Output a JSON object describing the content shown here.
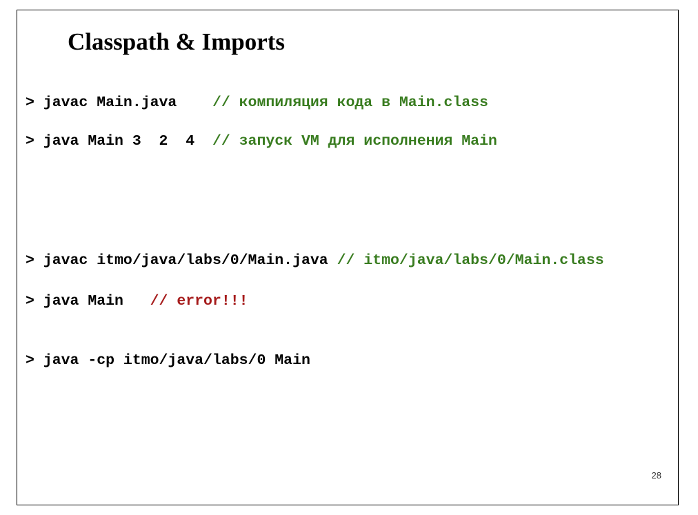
{
  "slide": {
    "title": "Classpath & Imports",
    "page_number": "28",
    "colors": {
      "command": "#000000",
      "comment": "#3a7d21",
      "error": "#a61c1c"
    },
    "lines": [
      {
        "command": "> javac Main.java    ",
        "comment": "// компиляция кода в Main.class"
      },
      {
        "command": "> java Main 3  2  4  ",
        "comment": "// запуск VM для исполнения Main"
      },
      {
        "command": "> javac itmo/java/labs/0/Main.java ",
        "comment": "// itmo/java/labs/0/Main.class"
      },
      {
        "command": "> java Main   ",
        "comment": "// error!!!"
      },
      {
        "command": "> java -cp itmo/java/labs/0 Main",
        "comment": ""
      }
    ]
  }
}
